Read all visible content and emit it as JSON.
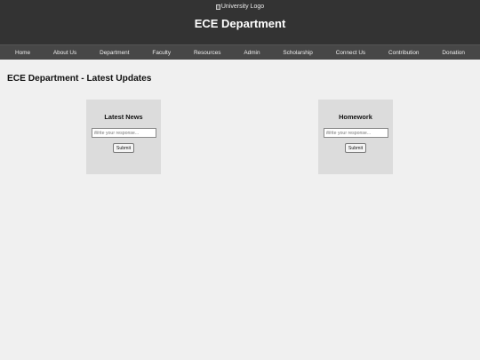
{
  "header": {
    "logo_alt": "University Logo",
    "title": "ECE Department"
  },
  "nav": {
    "items": [
      {
        "label": "Home"
      },
      {
        "label": "About Us"
      },
      {
        "label": "Department"
      },
      {
        "label": "Faculty"
      },
      {
        "label": "Resources"
      },
      {
        "label": "Admin"
      },
      {
        "label": "Scholarship"
      },
      {
        "label": "Connect Us"
      },
      {
        "label": "Contribution"
      },
      {
        "label": "Donation"
      }
    ]
  },
  "main": {
    "title": "ECE Department - Latest Updates",
    "cards": [
      {
        "title": "Latest News",
        "input_placeholder": "Write your response...",
        "button_label": "Submit"
      },
      {
        "title": "Homework",
        "input_placeholder": "Write your response...",
        "button_label": "Submit"
      }
    ]
  },
  "colors": {
    "header_bg": "#333333",
    "nav_bg": "#474747",
    "page_bg": "#f0f0f0",
    "card_bg": "#dcdcdc"
  }
}
